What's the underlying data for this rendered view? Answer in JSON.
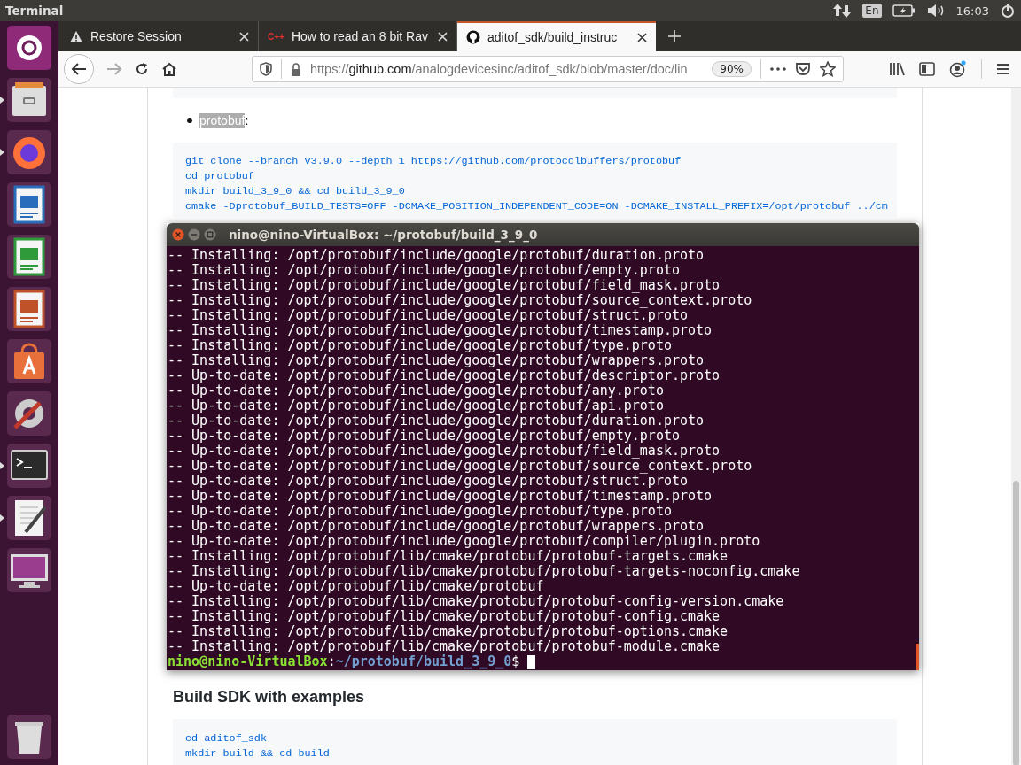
{
  "top_bar": {
    "app_title": "Terminal",
    "keyboard": "En",
    "clock": "16:03"
  },
  "launcher": [
    {
      "kind": "ubuntu",
      "running": false
    },
    {
      "kind": "files",
      "running": true
    },
    {
      "kind": "firefox",
      "running": true
    },
    {
      "kind": "writer",
      "running": false
    },
    {
      "kind": "calc",
      "running": false
    },
    {
      "kind": "impress",
      "running": false
    },
    {
      "kind": "software",
      "running": false
    },
    {
      "kind": "settings",
      "running": false
    },
    {
      "kind": "terminal",
      "running": true
    },
    {
      "kind": "editor",
      "running": true
    },
    {
      "kind": "display",
      "running": false
    },
    {
      "kind": "trash",
      "running": false
    }
  ],
  "browser": {
    "tabs": [
      {
        "kind": "warning",
        "title": "Restore Session",
        "selected": false
      },
      {
        "kind": "cpp",
        "icon_text": "C++",
        "title": "How to read an 8 bit Rav",
        "selected": false
      },
      {
        "kind": "github",
        "title": "aditof_sdk/build_instruc",
        "selected": true
      }
    ],
    "url": {
      "scheme": "https://",
      "domain": "github.com",
      "path": "/analogdevicesinc/aditof_sdk/blob/master/doc/lin"
    },
    "zoom": "90%"
  },
  "page": {
    "list_item": {
      "name": "protobuf",
      "suffix": ":"
    },
    "code_block_1": [
      "git clone --branch v3.9.0 --depth 1 https://github.com/protocolbuffers/protobuf",
      "cd protobuf",
      "mkdir build_3_9_0 && cd build_3_9_0",
      "cmake -Dprotobuf_BUILD_TESTS=OFF -DCMAKE_POSITION_INDEPENDENT_CODE=ON -DCMAKE_INSTALL_PREFIX=/opt/protobuf ../cm"
    ],
    "heading": "Build SDK with examples",
    "code_block_2": [
      "cd aditof_sdk",
      "mkdir build && cd build"
    ]
  },
  "terminal": {
    "title": "nino@nino-VirtualBox: ~/protobuf/build_3_9_0",
    "lines": [
      "-- Installing: /opt/protobuf/include/google/protobuf/duration.proto",
      "-- Installing: /opt/protobuf/include/google/protobuf/empty.proto",
      "-- Installing: /opt/protobuf/include/google/protobuf/field_mask.proto",
      "-- Installing: /opt/protobuf/include/google/protobuf/source_context.proto",
      "-- Installing: /opt/protobuf/include/google/protobuf/struct.proto",
      "-- Installing: /opt/protobuf/include/google/protobuf/timestamp.proto",
      "-- Installing: /opt/protobuf/include/google/protobuf/type.proto",
      "-- Installing: /opt/protobuf/include/google/protobuf/wrappers.proto",
      "-- Up-to-date: /opt/protobuf/include/google/protobuf/descriptor.proto",
      "-- Up-to-date: /opt/protobuf/include/google/protobuf/any.proto",
      "-- Up-to-date: /opt/protobuf/include/google/protobuf/api.proto",
      "-- Up-to-date: /opt/protobuf/include/google/protobuf/duration.proto",
      "-- Up-to-date: /opt/protobuf/include/google/protobuf/empty.proto",
      "-- Up-to-date: /opt/protobuf/include/google/protobuf/field_mask.proto",
      "-- Up-to-date: /opt/protobuf/include/google/protobuf/source_context.proto",
      "-- Up-to-date: /opt/protobuf/include/google/protobuf/struct.proto",
      "-- Up-to-date: /opt/protobuf/include/google/protobuf/timestamp.proto",
      "-- Up-to-date: /opt/protobuf/include/google/protobuf/type.proto",
      "-- Up-to-date: /opt/protobuf/include/google/protobuf/wrappers.proto",
      "-- Up-to-date: /opt/protobuf/include/google/protobuf/compiler/plugin.proto",
      "-- Installing: /opt/protobuf/lib/cmake/protobuf/protobuf-targets.cmake",
      "-- Installing: /opt/protobuf/lib/cmake/protobuf/protobuf-targets-noconfig.cmake",
      "-- Up-to-date: /opt/protobuf/lib/cmake/protobuf",
      "-- Installing: /opt/protobuf/lib/cmake/protobuf/protobuf-config-version.cmake",
      "-- Installing: /opt/protobuf/lib/cmake/protobuf/protobuf-config.cmake",
      "-- Installing: /opt/protobuf/lib/cmake/protobuf/protobuf-options.cmake",
      "-- Installing: /opt/protobuf/lib/cmake/protobuf/protobuf-module.cmake"
    ],
    "prompt": {
      "user_host": "nino@nino-VirtualBox",
      "separator": ":",
      "path": "~/protobuf/build_3_9_0",
      "symbol": "$"
    }
  }
}
